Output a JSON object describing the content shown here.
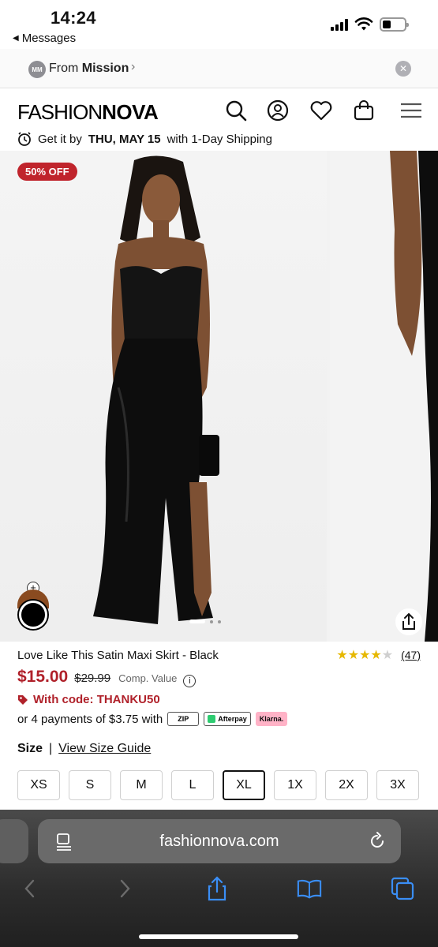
{
  "status_bar": {
    "time": "14:24",
    "back_app_label": "Messages",
    "battery_level": 0.4
  },
  "mission_banner": {
    "avatar_initials": "MM",
    "prefix": "From",
    "source": "Mission"
  },
  "header": {
    "logo_light": "FASHION",
    "logo_bold": "NOVA",
    "icons": [
      "search-icon",
      "account-icon",
      "wishlist-heart-icon",
      "shopping-bag-icon",
      "menu-icon"
    ]
  },
  "shipping": {
    "prefix": "Get it by",
    "date": "THU, MAY 15",
    "suffix": "with 1-Day Shipping"
  },
  "gallery": {
    "discount_badge": "50% OFF",
    "swatch_plus": "+",
    "slide_count": 3,
    "active_slide": 1
  },
  "product": {
    "title": "Love Like This Satin Maxi Skirt - Black",
    "rating": 4,
    "rating_max": 5,
    "review_count": "(47)",
    "price_now": "$15.00",
    "price_was": "$29.99",
    "comp_value_label": "Comp. Value",
    "code_text": "With code: THANKU50",
    "installment_text": "or 4 payments of $3.75 with",
    "pay_badges": {
      "zip": "ZIP",
      "afterpay": "Afterpay",
      "klarna": "Klarna."
    },
    "colors": {
      "price_red": "#b0212a",
      "badge_red": "#c0242c",
      "star_gold": "#e6b800"
    }
  },
  "size": {
    "label": "Size",
    "guide": "View Size Guide",
    "options": [
      "XS",
      "S",
      "M",
      "L",
      "XL",
      "1X",
      "2X",
      "3X"
    ],
    "selected": "XL"
  },
  "safari": {
    "url": "fashionnova.com"
  }
}
